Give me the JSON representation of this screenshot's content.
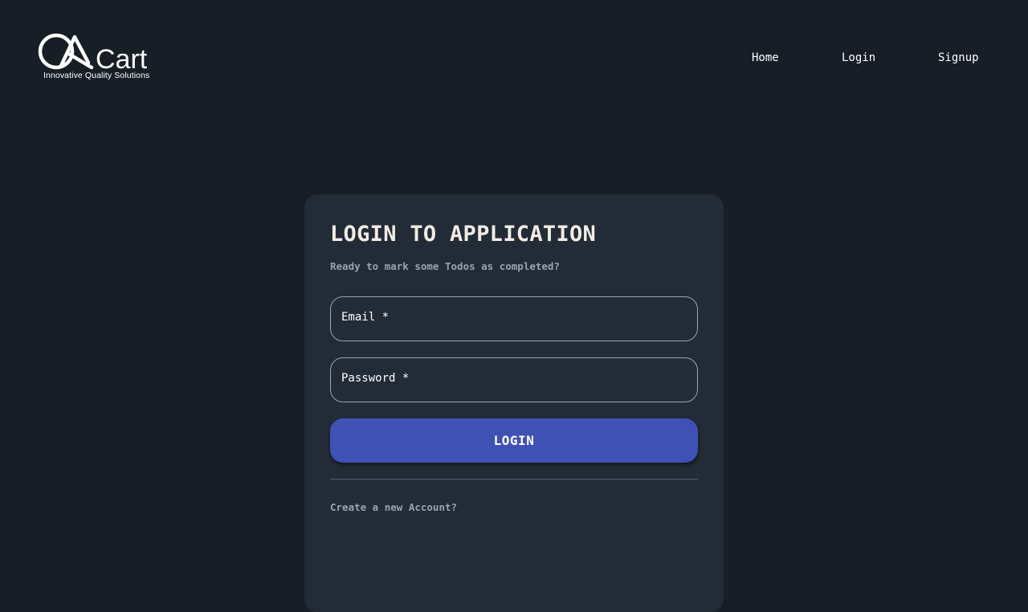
{
  "header": {
    "logo": {
      "brand_text": "QACart",
      "tagline": "Innovative Quality Solutions"
    },
    "nav": {
      "home": "Home",
      "login": "Login",
      "signup": "Signup"
    }
  },
  "login_card": {
    "title": "LOGIN TO APPLICATION",
    "subtitle": "Ready to mark some Todos as completed?",
    "email_label": "Email *",
    "password_label": "Password *",
    "login_button": "LOGIN",
    "create_account_link": "Create a new Account?"
  },
  "colors": {
    "background": "#171e26",
    "card": "#222b36",
    "accent": "#3f51b5"
  }
}
